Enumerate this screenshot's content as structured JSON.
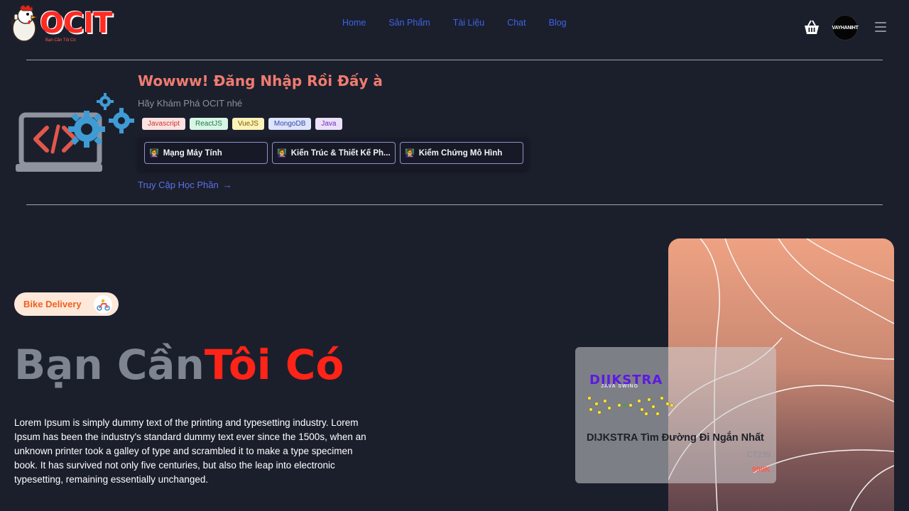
{
  "header": {
    "logo_text": "OCIT",
    "logo_sub": "Bạn Cần Tôi Có",
    "nav": [
      "Home",
      "Sản Phẩm",
      "Tài Liệu",
      "Chat",
      "Blog"
    ],
    "avatar_text": "VAYHANIHT"
  },
  "welcome": {
    "title": "Wowww! Đăng Nhập Rồi Đấy à",
    "subtitle": "Hãy Khám Phá OCIT nhé",
    "tags": [
      "Javascript",
      "ReactJS",
      "VueJS",
      "MongoDB",
      "Java"
    ],
    "courses": [
      "Mạng Máy Tính",
      "Kiến Trúc & Thiết Kế Ph...",
      "Kiểm Chứng Mô Hình"
    ],
    "access_link": "Truy Cập Học Phần"
  },
  "hero": {
    "badge": "Bike Delivery",
    "title_part1": "Bạn Cần",
    "title_part2": "Tôi Có",
    "description": "Lorem Ipsum is simply dummy text of the printing and typesetting industry. Lorem Ipsum has been the industry's standard dummy text ever since the 1500s, when an unknown printer took a galley of type and scrambled it to make a type specimen book. It has survived not only five centuries, but also the leap into electronic typesetting, remaining essentially unchanged."
  },
  "product": {
    "image_title": "DIJKSTRA",
    "image_subtitle": "JAVA SWING",
    "name": "DIJKSTRA Tìm Đường Đi Ngắn Nhất",
    "code": "CT239",
    "price": "999K"
  },
  "colors": {
    "background": "#1b1f2c",
    "nav_link": "#3e63e6",
    "accent_red": "#ff2417",
    "welcome_title": "#f07b70"
  },
  "icons": {
    "cart": "basket-icon",
    "menu": "hamburger-icon",
    "access_arrow": "arrow-right-icon",
    "course": "student-icon",
    "delivery": "scooter-icon"
  }
}
